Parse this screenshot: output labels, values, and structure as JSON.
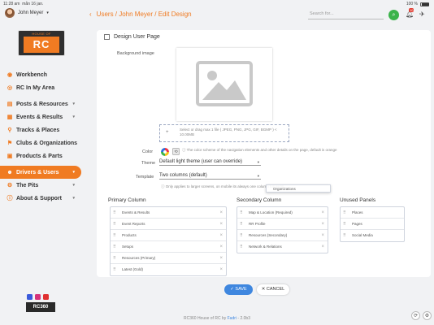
{
  "status": {
    "time": "11:28 am",
    "date": "mån 16 jan.",
    "battery": "100 %"
  },
  "user": {
    "name": "John Meyer",
    "caret": "▾"
  },
  "breadcrumb": {
    "back": "‹",
    "path": "Users / John Meyer / Edit Design"
  },
  "search": {
    "placeholder": "Search for..."
  },
  "notifications": {
    "count": "10"
  },
  "logo": {
    "header": "HOUSE OF",
    "mark": "RC"
  },
  "nav": [
    {
      "label": "Workbench",
      "icon": "◉",
      "has_caret": false
    },
    {
      "label": "RC In My Area",
      "icon": "◎",
      "has_caret": false
    },
    {
      "label": "Posts & Resources",
      "icon": "▤",
      "has_caret": true
    },
    {
      "label": "Events & Results",
      "icon": "▦",
      "has_caret": true
    },
    {
      "label": "Tracks & Places",
      "icon": "⚲",
      "has_caret": false
    },
    {
      "label": "Clubs & Organizations",
      "icon": "⚑",
      "has_caret": false
    },
    {
      "label": "Products & Parts",
      "icon": "▣",
      "has_caret": false
    },
    {
      "label": "Drivers & Users",
      "icon": "☻",
      "has_caret": true,
      "active": true
    },
    {
      "label": "The Pits",
      "icon": "⚙",
      "has_caret": true
    },
    {
      "label": "About & Support",
      "icon": "ⓘ",
      "has_caret": true
    }
  ],
  "nav_caret": "▾",
  "brand_badge": "RC360",
  "page": {
    "title": "Design User Page",
    "background_label": "Background image",
    "dropzone_text": "Select or drag max 1 file ( JPEG, PNG, JPG, GIF, BGMP ) < 10.00MB",
    "color_label": "Color",
    "color_hint": "The color scheme of the navigation elements and other details on the page, default is orange",
    "theme_label": "Theme",
    "theme_value": "Default light theme (user can override)",
    "template_label": "Template",
    "template_value": "Two columns (default)",
    "template_hint": "Only applies to larger screens, on mobile its always one column full width"
  },
  "columns": {
    "primary": {
      "title": "Primary Column",
      "items": [
        "Events & Results",
        "Event Reports",
        "Products",
        "Setups",
        "Resources (Primary)",
        "Latest (Gold)"
      ]
    },
    "secondary": {
      "title": "Secondary Column",
      "items": [
        "Map & Location (Required)",
        "RR Profile",
        "Resources (Secondary)",
        "Network & Relations"
      ]
    },
    "unused": {
      "title": "Unused Panels",
      "items": [
        "Places",
        "Pages",
        "Social Media"
      ],
      "dragging": "Organizations"
    }
  },
  "actions": {
    "save": "✓ SAVE",
    "cancel": "✕ CANCEL"
  },
  "footer": {
    "text": "RC360 House of RC by",
    "link": "Fadri",
    "version": " - 2.0b3"
  },
  "colors": {
    "accent": "#f07b22",
    "primary": "#3f87df",
    "success": "#3bb34a"
  }
}
